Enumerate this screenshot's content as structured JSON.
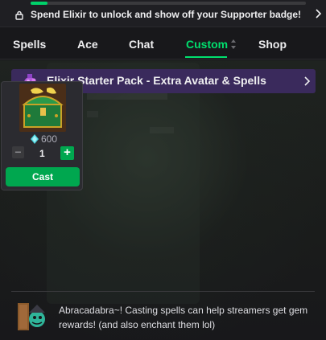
{
  "banner": {
    "text": "Spend Elixir to unlock and show off your Supporter badge!",
    "progress": 0.06,
    "lock_icon": "lock-icon",
    "chevron_icon": "chevron-right-icon"
  },
  "tabs": [
    {
      "label": "Spells",
      "active": false
    },
    {
      "label": "Ace",
      "active": false
    },
    {
      "label": "Chat",
      "active": false
    },
    {
      "label": "Custom",
      "active": true
    },
    {
      "label": "Shop",
      "active": false
    }
  ],
  "pack": {
    "title": "Elixir Starter Pack - Extra Avatar & Spells",
    "icon": "potion-icon",
    "chevron_icon": "chevron-right-icon"
  },
  "card": {
    "thumbnail_icon": "treasure-chest-icon",
    "price": "600",
    "price_icon": "gem-icon",
    "quantity": "1",
    "minus_label": "−",
    "plus_label": "+",
    "cast_label": "Cast"
  },
  "footer": {
    "avatar_icon": "wizard-mascot-icon",
    "message": "Abracadabra~! Casting spells can help streamers get gem rewards! (and also enchant them lol)"
  },
  "colors": {
    "accent": "#00e06e",
    "button": "#00a74f",
    "pack_bar": "#3a2a5c",
    "background": "#18181b"
  }
}
